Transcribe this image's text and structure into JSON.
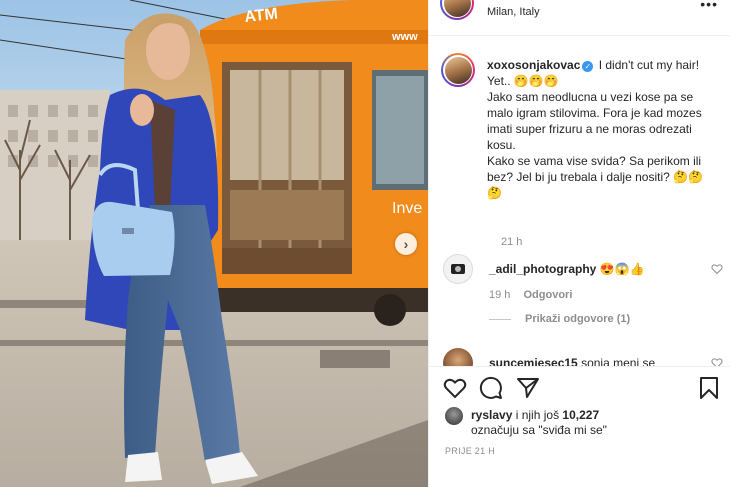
{
  "post": {
    "location": "Milan, Italy",
    "photo_sign_top": "ATM",
    "photo_sign_web": "www",
    "photo_tram_text": "Inve"
  },
  "caption": {
    "username": "xoxosonjakovac",
    "first_line": "I didn't cut my hair! Yet.. 🤭🤭🤭",
    "body": "Jako sam neodlucna u vezi kose pa se malo igram stilovima. Fora je kad mozes imati super frizuru a ne moras odrezati kosu.\nKako se vama vise svida? Sa perikom ili bez? Jel bi ju trebala i dalje nositi? 🤔🤔🤔",
    "time": "21 h"
  },
  "comments": [
    {
      "username": "_adil_photography",
      "text": "😍😱👍",
      "time": "19 h",
      "reply_label": "Odgovori",
      "view_replies": "Prikaži odgovore (1)"
    },
    {
      "username": "suncemjesec15",
      "text": "sonja meni se"
    }
  ],
  "likes": {
    "name": "ryslavy",
    "middle": "i njih još",
    "count": "10,227",
    "suffix": "označuju sa \"sviđa mi se\""
  },
  "date": "PRIJE 21 H",
  "icons": {
    "like": "heart-icon",
    "comment": "comment-icon",
    "share": "paper-plane-icon",
    "save": "bookmark-icon",
    "next": "chevron-right-icon",
    "more": "more-icon"
  },
  "colors": {
    "verified": "#3897f0",
    "muted": "#8e8e8e",
    "text": "#262626",
    "tram": "#f08b1c"
  }
}
